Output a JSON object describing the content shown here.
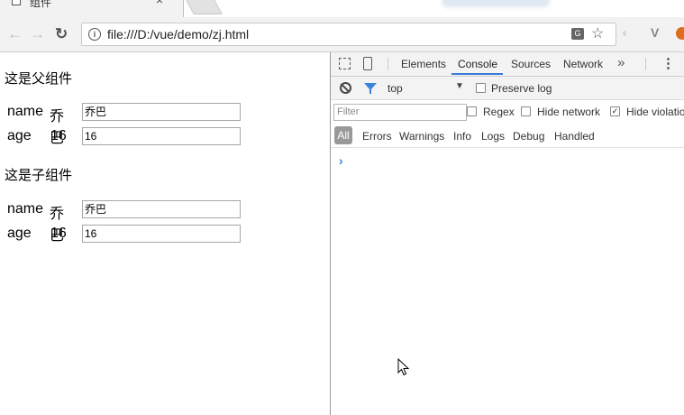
{
  "tab": {
    "title": "组件",
    "close": "×"
  },
  "toolbar": {
    "back": "←",
    "forward": "→",
    "reload": "↻",
    "url": "file:///D:/vue/demo/zj.html",
    "info": "i",
    "translate": "G",
    "star": "☆",
    "ext2": "V"
  },
  "page": {
    "parent": {
      "heading": "这是父组件",
      "name_label": "name",
      "name_value": "乔巴",
      "name_input": "乔巴",
      "age_label": "age",
      "age_value": "16",
      "age_input": "16"
    },
    "child": {
      "heading": "这是子组件",
      "name_label": "name",
      "name_value": "乔巴",
      "name_input": "乔巴",
      "age_label": "age",
      "age_value": "16",
      "age_input": "16"
    }
  },
  "devtools": {
    "tabs": [
      "Elements",
      "Console",
      "Sources",
      "Network"
    ],
    "active_tab": "Console",
    "more": "»",
    "menu": "⋮",
    "context": "top",
    "context_arrow": "▼",
    "preserve_log": "Preserve log",
    "filter_placeholder": "Filter",
    "regex": "Regex",
    "hide_network": "Hide network",
    "hide_violations": "Hide violations",
    "hide_violations_checked": "✓",
    "levels": [
      "All",
      "Errors",
      "Warnings",
      "Info",
      "Logs",
      "Debug",
      "Handled"
    ],
    "prompt": "›"
  },
  "colors": {
    "accent": "#3879d9",
    "filter_blue": "#3a84df"
  }
}
